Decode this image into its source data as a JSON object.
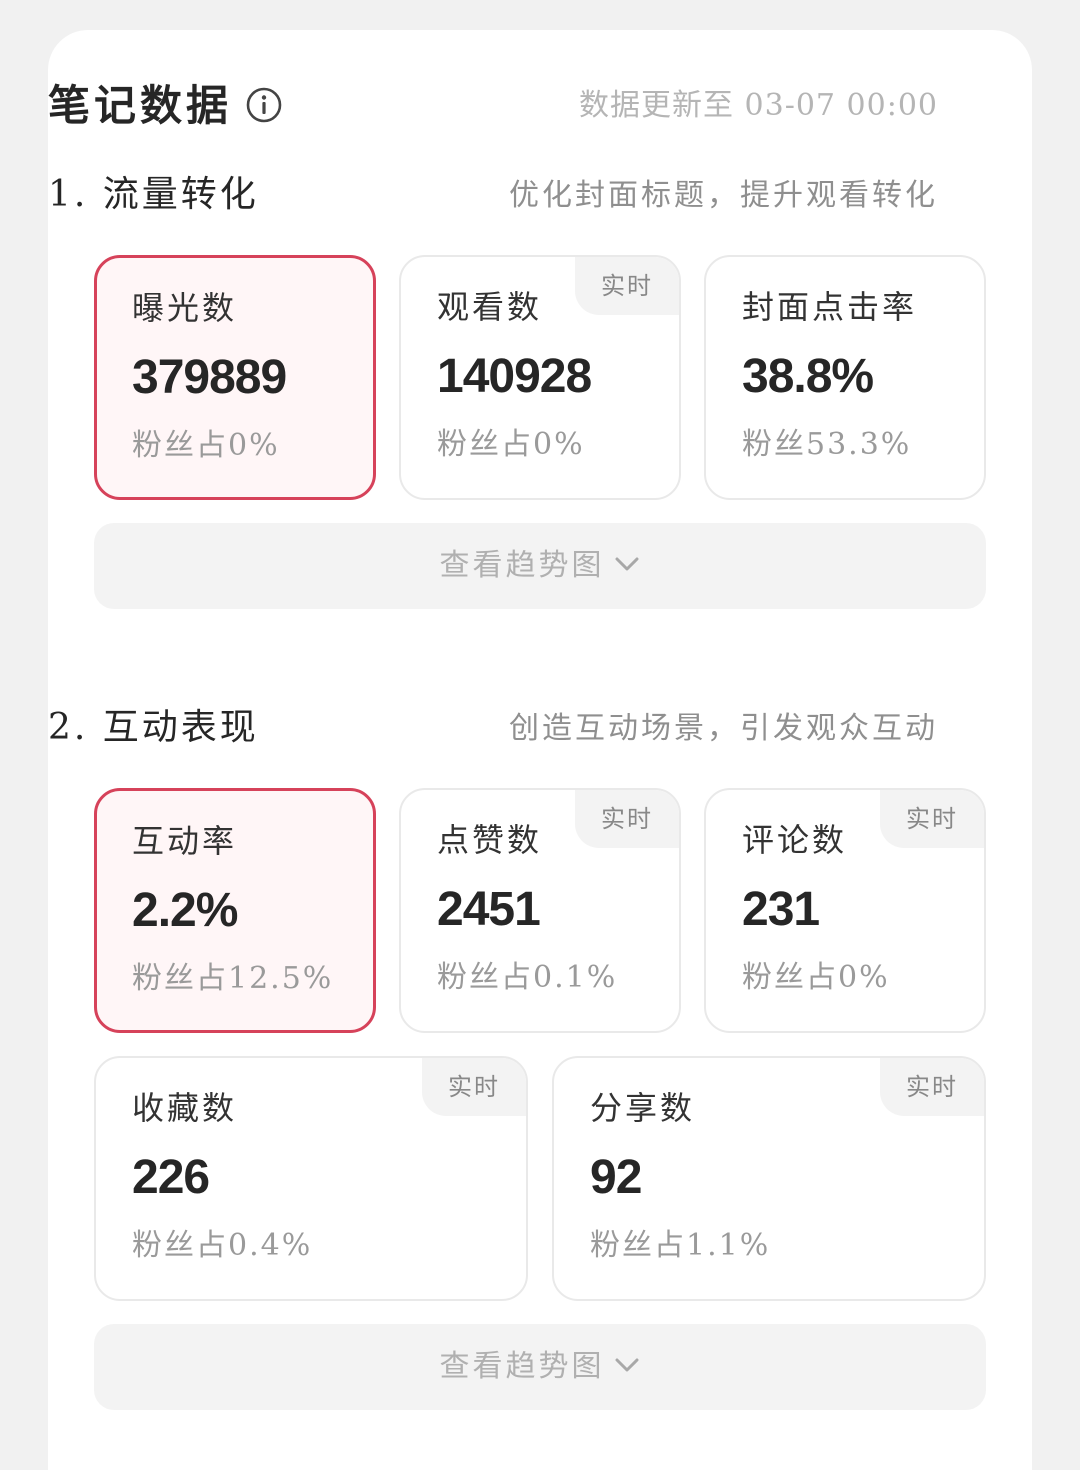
{
  "header": {
    "title": "笔记数据",
    "update_time": "数据更新至 03-07 00:00"
  },
  "sections": [
    {
      "title": "1. 流量转化",
      "tip": "优化封面标题，提升观看转化",
      "metrics": [
        {
          "label": "曝光数",
          "value": "379889",
          "sub": "粉丝占0%",
          "badge": null,
          "selected": true
        },
        {
          "label": "观看数",
          "value": "140928",
          "sub": "粉丝占0%",
          "badge": "实时",
          "selected": false
        },
        {
          "label": "封面点击率",
          "value": "38.8%",
          "sub": "粉丝53.3%",
          "badge": null,
          "selected": false
        }
      ],
      "trend_label": "查看趋势图"
    },
    {
      "title": "2. 互动表现",
      "tip": "创造互动场景，引发观众互动",
      "metrics": [
        {
          "label": "互动率",
          "value": "2.2%",
          "sub": "粉丝占12.5%",
          "badge": null,
          "selected": true
        },
        {
          "label": "点赞数",
          "value": "2451",
          "sub": "粉丝占0.1%",
          "badge": "实时",
          "selected": false
        },
        {
          "label": "评论数",
          "value": "231",
          "sub": "粉丝占0%",
          "badge": "实时",
          "selected": false
        },
        {
          "label": "收藏数",
          "value": "226",
          "sub": "粉丝占0.4%",
          "badge": "实时",
          "selected": false
        },
        {
          "label": "分享数",
          "value": "92",
          "sub": "粉丝占1.1%",
          "badge": "实时",
          "selected": false
        }
      ],
      "trend_label": "查看趋势图"
    }
  ],
  "colors": {
    "accent": "#d6425a",
    "selected_bg": "#fff6f7",
    "page_bg": "#f1f1f1"
  },
  "icons": {
    "info": "info-circle-icon",
    "chevron": "chevron-down-icon"
  }
}
